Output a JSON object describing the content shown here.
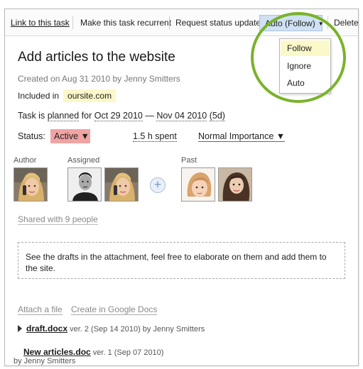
{
  "toolbar": {
    "link_label": "Link to this task",
    "recurrent_label": "Make this task recurrent",
    "status_update_label": "Request status update",
    "follow_dropdown_label": "Auto (Follow)",
    "delete_label": "Delete"
  },
  "follow_menu": {
    "options": [
      "Follow",
      "Ignore",
      "Auto"
    ],
    "highlighted": "Follow"
  },
  "task": {
    "title": "Add articles to the website",
    "created": "Created on Aug 31 2010 by Jenny Smitters",
    "included_label": "Included in",
    "included_site": "oursite.com",
    "planned_prefix": "Task is",
    "planned_word": "planned",
    "planned_for": "for",
    "start_date": "Oct 29 2010",
    "date_sep": "—",
    "end_date": "Nov 04 2010",
    "duration": "(5d)",
    "status_label": "Status:",
    "status_value": "Active ▼",
    "time_spent": "1.5 h spent",
    "importance": "Normal Importance ▼"
  },
  "people": {
    "author_label": "Author",
    "assigned_label": "Assigned",
    "past_label": "Past",
    "add_symbol": "+"
  },
  "shared": "Shared with 9 people",
  "description": "See the drafts in the attachment, feel free to elaborate on them and add them to the site.",
  "attachments": {
    "attach_label": "Attach a file",
    "gdocs_label": "Create in Google Docs",
    "files": [
      {
        "name": "draft.docx",
        "meta": "ver. 2 (Sep 14 2010) by Jenny Smitters"
      },
      {
        "name": "New articles.doc",
        "meta": "ver. 1 (Sep 07 2010)",
        "meta2": "by Jenny Smitters"
      }
    ]
  },
  "colors": {
    "status_active": "#f1a3a3",
    "highlight_ring": "#7ab22a",
    "site_tag": "#fbf7c9",
    "dropdown_button": "#cfe1f3"
  }
}
